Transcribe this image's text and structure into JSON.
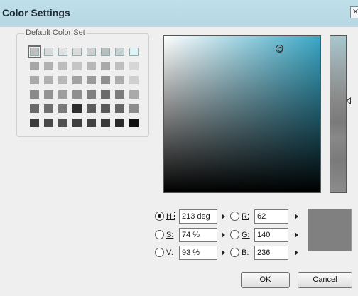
{
  "window": {
    "title": "Color Settings",
    "close_glyph": "✕"
  },
  "default_set": {
    "label": "Default Color Set",
    "swatches": [
      [
        "#bfbfbf",
        "#d9d9d9",
        "#e2e2e2",
        "#dcdcdc",
        "#cfcfcf",
        "#b8bfc1",
        "#c8d2d4",
        "#dcf4f6"
      ],
      [
        "#a6a6a6",
        "#b1b1b1",
        "#bdbdbd",
        "#c5c5c5",
        "#b7b7b7",
        "#a9a9a9",
        "#bfbfbf",
        "#d6d6d6"
      ],
      [
        "#a9a9a9",
        "#b0b0b0",
        "#b8b8b8",
        "#a2a2a2",
        "#9a9a9a",
        "#8e8e8e",
        "#acacac",
        "#cfcfcf"
      ],
      [
        "#8a8a8a",
        "#939393",
        "#9f9f9f",
        "#8f8f8f",
        "#7f7f7f",
        "#6a6a6a",
        "#7c7c7c",
        "#aaaaaa"
      ],
      [
        "#6a6a6a",
        "#6e6e6e",
        "#797979",
        "#2e2e2e",
        "#5d5d5d",
        "#595959",
        "#666666",
        "#8c8c8c"
      ],
      [
        "#3b3b3b",
        "#474747",
        "#515151",
        "#3e3e3e",
        "#424242",
        "#3a3a3a",
        "#2a2a2a",
        "#111111"
      ]
    ],
    "selected_index": [
      0,
      0
    ]
  },
  "hsv": {
    "h": {
      "label": "H:",
      "value": "213 deg",
      "checked": true
    },
    "s": {
      "label": "S:",
      "value": "74 %",
      "checked": false
    },
    "v": {
      "label": "V:",
      "value": "93 %",
      "checked": false
    }
  },
  "rgb": {
    "r": {
      "label": "R:",
      "value": "62",
      "checked": false
    },
    "g": {
      "label": "G:",
      "value": "140",
      "checked": false
    },
    "b": {
      "label": "B:",
      "value": "236",
      "checked": false
    }
  },
  "buttons": {
    "ok": "OK",
    "cancel": "Cancel"
  },
  "colors": {
    "preview": "#808080"
  }
}
